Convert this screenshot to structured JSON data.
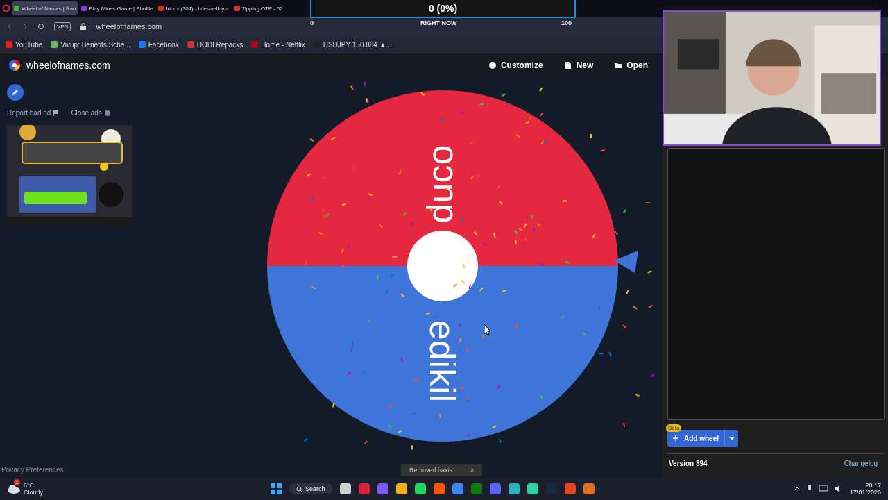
{
  "browser": {
    "tabs": [
      {
        "label": "Wheel of Names | Ran",
        "selected": true
      },
      {
        "label": "Play Mines Game | Shuffle",
        "selected": false
      },
      {
        "label": "Inbox (304) - tideswelldyla",
        "selected": false
      },
      {
        "label": "Tipping OTP - 52",
        "selected": false
      }
    ],
    "vpn": "VPN",
    "address": "wheelofnames.com",
    "bookmarks": [
      "YouTube",
      "Vivup: Benefits Sche...",
      "Facebook",
      "DODI Repacks",
      "Home - Netflix",
      "USDJPY 150.884 ▲..."
    ]
  },
  "overlay": {
    "value": "0 (0%)",
    "min": "0",
    "caption": "RIGHT NOW",
    "max": "100"
  },
  "site": {
    "title": "wheelofnames.com",
    "actions": [
      "Customize",
      "New",
      "Open"
    ]
  },
  "ads": {
    "report": "Report bad ad",
    "close": "Close ads"
  },
  "wheel": {
    "slices": [
      {
        "label": "duco",
        "color": "#e3283f"
      },
      {
        "label": "edikil",
        "color": "#3f75d8"
      }
    ]
  },
  "panel": {
    "badge": "Beta",
    "add_button": "Add wheel",
    "version": "Version 394",
    "changelog": "Changelog"
  },
  "privacy": "Privacy Preferences",
  "toast": {
    "message": "Removed haxis",
    "close": "×"
  },
  "taskbar": {
    "weather": {
      "badge": "1",
      "temp": "6°C",
      "condition": "Cloudy"
    },
    "search": "Search",
    "time": "20:17",
    "date": "17/01/2026"
  }
}
